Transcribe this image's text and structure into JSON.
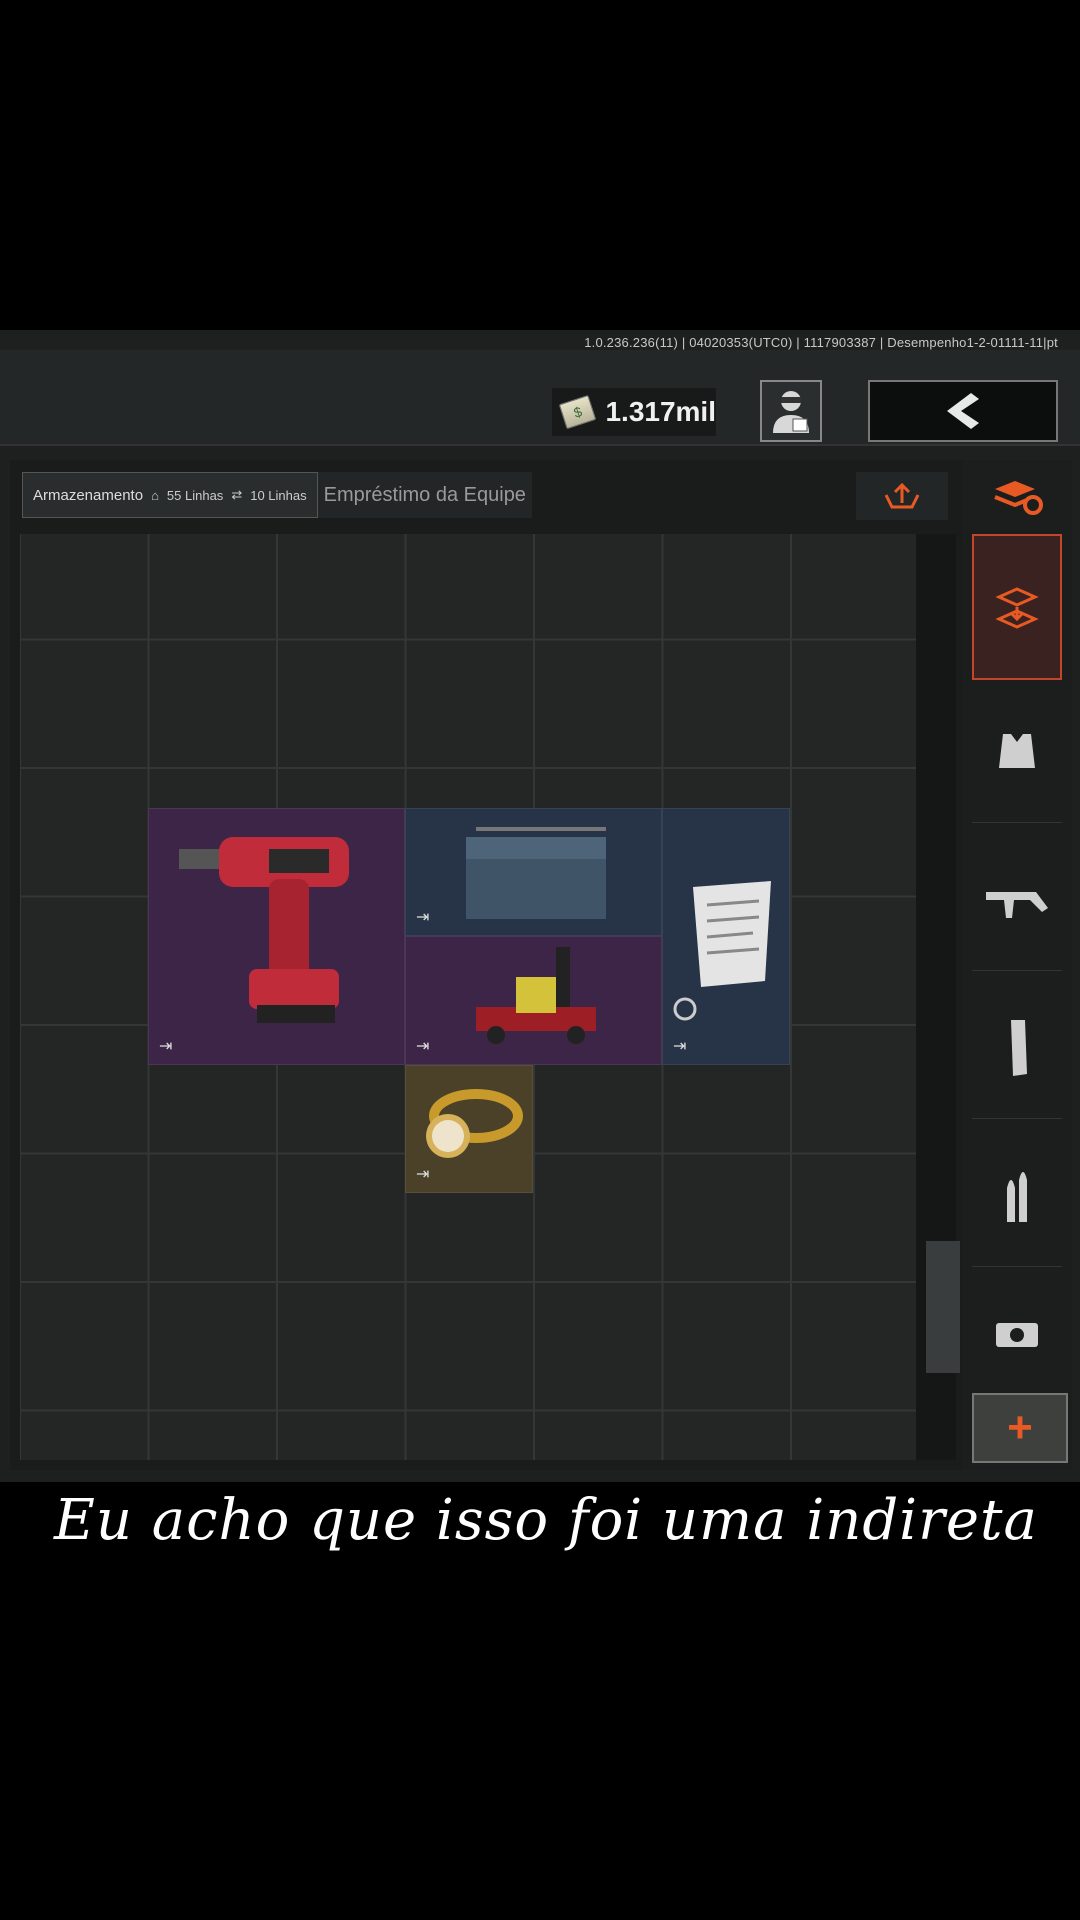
{
  "header": {
    "version_info": "1.0.236.236(11) | 04020353(UTC0) | 1117903387 | Desempenho1-2-01111-11|pt",
    "money_amount": "1.317mil"
  },
  "tabs": {
    "storage_label": "Armazenamento",
    "home_rows": "55 Linhas",
    "other_rows": "10 Linhas",
    "team_loan_label": "Empréstimo da Equipe"
  },
  "inventory": {
    "items": [
      {
        "name": "drill",
        "color": "#3d2548"
      },
      {
        "name": "toolbox",
        "color": "#273347"
      },
      {
        "name": "document",
        "color": "#273347"
      },
      {
        "name": "floor-jack",
        "color": "#3d2548"
      },
      {
        "name": "gold-watch",
        "color": "#4a4128"
      }
    ]
  },
  "sidebar": {
    "icons": [
      "layers-refresh-icon",
      "storage-transfer-icon",
      "vest-icon",
      "rifle-icon",
      "magazine-icon",
      "ammo-icon",
      "sight-icon"
    ],
    "add_label": "+",
    "accent": "#e85a24"
  },
  "caption": "Eu acho que isso foi uma indireta"
}
